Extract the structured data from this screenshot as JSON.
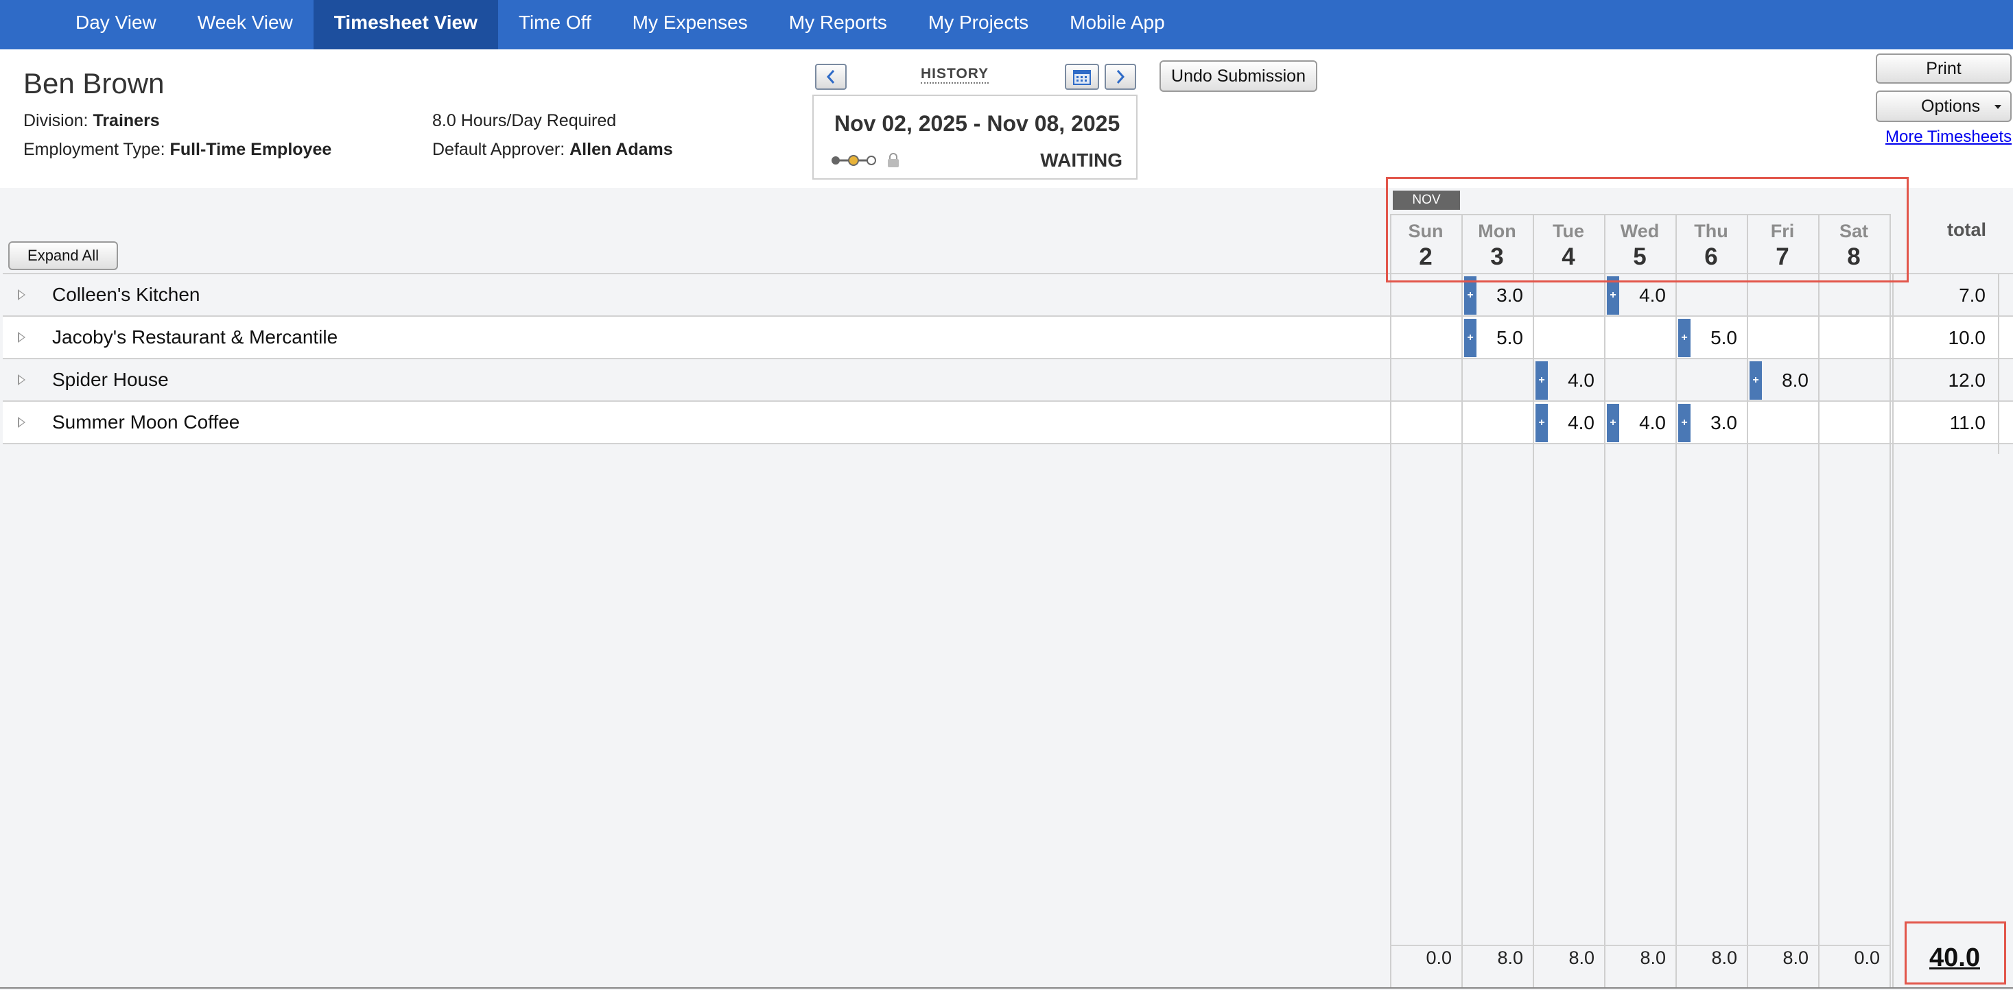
{
  "nav": {
    "items": [
      "Day View",
      "Week View",
      "Timesheet View",
      "Time Off",
      "My Expenses",
      "My Reports",
      "My Projects",
      "Mobile App"
    ],
    "active": "Timesheet View"
  },
  "employee": {
    "name": "Ben Brown",
    "division_label": "Division:",
    "division": "Trainers",
    "employment_label": "Employment Type:",
    "employment_type": "Full-Time Employee",
    "hours_required": "8.0 Hours/Day Required",
    "approver_label": "Default Approver:",
    "approver": "Allen Adams"
  },
  "period": {
    "history_label": "HISTORY",
    "range": "Nov 02, 2025 - Nov 08, 2025",
    "status": "WAITING"
  },
  "buttons": {
    "undo": "Undo Submission",
    "print": "Print",
    "options": "Options",
    "expand_all": "Expand All",
    "more_timesheets": "More Timesheets"
  },
  "grid": {
    "month": "NOV",
    "total_label": "total",
    "days": [
      {
        "name": "Sun",
        "date": "2"
      },
      {
        "name": "Mon",
        "date": "3"
      },
      {
        "name": "Tue",
        "date": "4"
      },
      {
        "name": "Wed",
        "date": "5"
      },
      {
        "name": "Thu",
        "date": "6"
      },
      {
        "name": "Fri",
        "date": "7"
      },
      {
        "name": "Sat",
        "date": "8"
      }
    ],
    "rows": [
      {
        "project": "Colleen's Kitchen",
        "hours": [
          "",
          "3.0",
          "",
          "4.0",
          "",
          "",
          ""
        ],
        "total": "7.0"
      },
      {
        "project": "Jacoby's Restaurant & Mercantile",
        "hours": [
          "",
          "5.0",
          "",
          "",
          "5.0",
          "",
          ""
        ],
        "total": "10.0"
      },
      {
        "project": "Spider House",
        "hours": [
          "",
          "",
          "4.0",
          "",
          "",
          "8.0",
          ""
        ],
        "total": "12.0"
      },
      {
        "project": "Summer Moon Coffee",
        "hours": [
          "",
          "",
          "4.0",
          "4.0",
          "3.0",
          "",
          ""
        ],
        "total": "11.0"
      }
    ],
    "day_totals": [
      "0.0",
      "8.0",
      "8.0",
      "8.0",
      "8.0",
      "8.0",
      "0.0"
    ],
    "grand_total": "40.0"
  },
  "colors": {
    "nav_bg": "#2f6bc7",
    "nav_active": "#1d4f9e",
    "entry_marker": "#4a78b5",
    "highlight": "#e2564b",
    "progress_done": "#e8b339"
  }
}
